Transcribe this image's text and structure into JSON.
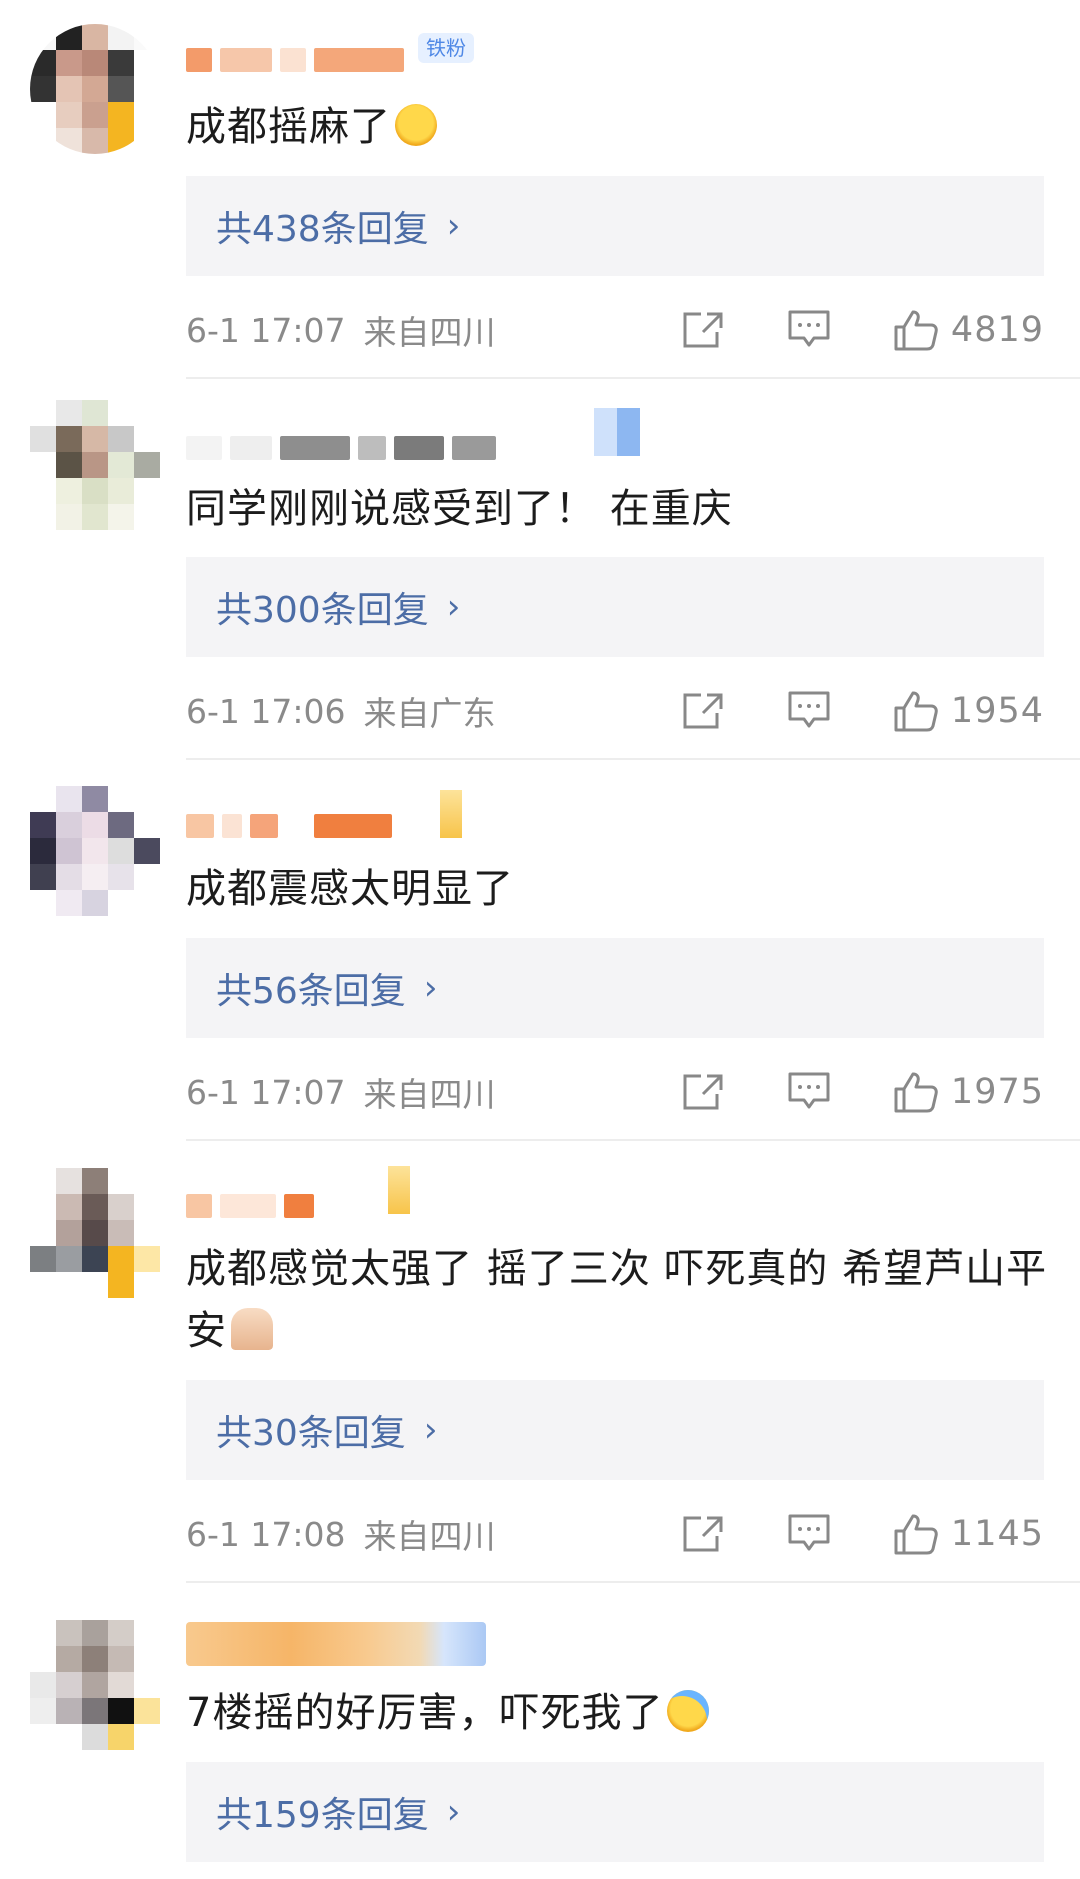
{
  "comments": [
    {
      "badge": "铁粉",
      "text": "成都摇麻了",
      "emoji": "laughing-crying-emoji",
      "replies": "共438条回复",
      "chevron": "›",
      "time": "6-1 17:07",
      "location": "来自四川",
      "likes": "4819"
    },
    {
      "badge": "",
      "text": "同学刚刚说感受到了！ 在重庆",
      "emoji": "",
      "replies": "共300条回复",
      "chevron": "›",
      "time": "6-1 17:06",
      "location": "来自广东",
      "likes": "1954"
    },
    {
      "badge": "",
      "text": "成都震感太明显了",
      "emoji": "",
      "replies": "共56条回复",
      "chevron": "›",
      "time": "6-1 17:07",
      "location": "来自四川",
      "likes": "1975"
    },
    {
      "badge": "",
      "text": "成都感觉太强了 摇了三次 吓死真的 希望芦山平安",
      "emoji": "pray-emoji",
      "replies": "共30条回复",
      "chevron": "›",
      "time": "6-1 17:08",
      "location": "来自四川",
      "likes": "1145"
    },
    {
      "badge": "",
      "text": "7楼摇的好厉害，吓死我了",
      "emoji": "crying-emoji",
      "replies": "共159条回复",
      "chevron": "›",
      "time": "",
      "location": "",
      "likes": ""
    }
  ],
  "colors": {
    "reply_link": "#4c6da6",
    "meta_gray": "#8a8a8a",
    "reply_bg": "#f4f4f6",
    "badge_blue": "#4f88e6"
  },
  "icons": {
    "share": "share-icon",
    "comment": "comment-icon",
    "like": "thumbs-up-icon"
  }
}
